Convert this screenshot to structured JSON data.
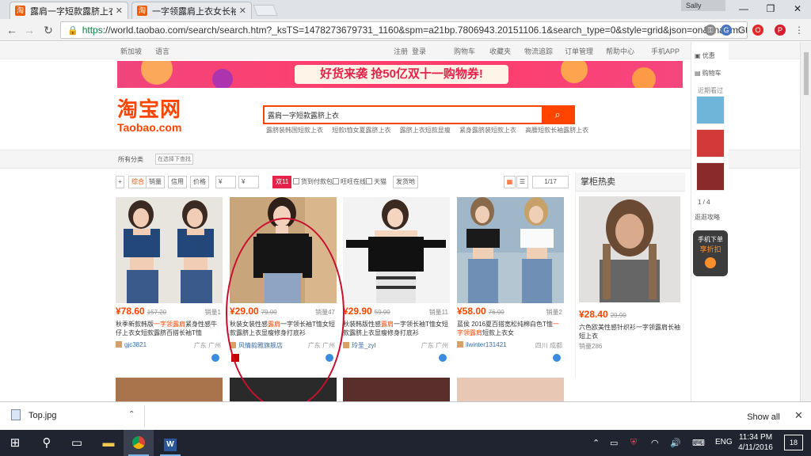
{
  "browser": {
    "tabs": [
      {
        "title": "露肩一字短款露脐上衣_",
        "active": true
      },
      {
        "title": "一字领露肩上衣女长袖t恤",
        "active": false
      }
    ],
    "user": "Sally",
    "url_scheme": "https",
    "url_rest": "://world.taobao.com/search/search.htm?_ksTS=1478273679731_1160&spm=a21bp.7806943.20151106.1&search_type=0&style=grid&json=on&cna=mGt0"
  },
  "site_topbar": {
    "left": [
      "新加坡",
      "语言"
    ],
    "right": [
      "注册",
      "登录",
      "购物车",
      "收藏夹",
      "物流追踪",
      "订单管理",
      "帮助中心",
      "手机APP"
    ]
  },
  "banner": {
    "text": "好货来袭 抢50亿双十一购物券!"
  },
  "logo": {
    "cn": "淘宝网",
    "en": "Taobao.com"
  },
  "search": {
    "query": "露肩一字短款露脐上衣",
    "button_icon": "search-icon",
    "hot_terms": [
      "露脐装韩国短款上衣",
      "短款t恤女夏露脐上衣",
      "露脐上衣短款显瘦",
      "紧身露脐装短款上衣",
      "高腰短款长袖露脐上衣"
    ]
  },
  "category_bar": {
    "label": "所有分类",
    "placeholder": "在选择下查找"
  },
  "filters": {
    "sort": [
      "综合",
      "销量",
      "信用",
      "价格"
    ],
    "price_from": "¥",
    "price_to": "¥",
    "badge": "双11",
    "checks": [
      "货到付款包邮",
      "旺旺在线",
      "天猫"
    ],
    "ship": "发货地",
    "page": "1/17"
  },
  "products": [
    {
      "price": "¥78.60",
      "old": "157.20",
      "sales": "销量1",
      "title_pre": "秋季新款韩版",
      "title_hl": "一字领露肩",
      "title_post": "紧身性感牛仔上衣女短款露脐百搭长袖T恤",
      "shop": "gjc3821",
      "loc": "广东 广州"
    },
    {
      "price": "¥29.00",
      "old": "79.00",
      "sales": "销量47",
      "title_pre": "秋装女装性感",
      "title_hl": "露肩",
      "title_post": "一字领长袖T恤女短款露脐上衣显瘦修身打底衫",
      "shop": "风情韵雅旗舰店",
      "loc": "广东 广州"
    },
    {
      "price": "¥29.90",
      "old": "59.00",
      "sales": "销量11",
      "title_pre": "秋装韩版性感",
      "title_hl": "露肩",
      "title_post": "一字领长袖T恤女短款露脐上衣显瘦修身打底衫",
      "shop": "玲圣_zyl",
      "loc": "广东 广州"
    },
    {
      "price": "¥58.00",
      "old": "76.00",
      "sales": "销量2",
      "title_pre": "蓝侯 2016夏百搭宽松纯棉白色T恤",
      "title_hl": "一字领露肩",
      "title_post": "短款上衣女",
      "shop": "ilwinter131421",
      "loc": "四川 成都"
    }
  ],
  "side_ad": {
    "title": "掌柜热卖",
    "price": "¥28.40",
    "old": "29.90",
    "desc": "六色欧美性感针织衫一字领露肩长袖短上衣",
    "sales": "销量286"
  },
  "right_bar": {
    "items": [
      "优惠",
      "购物车"
    ],
    "recent": "近期看过",
    "pager": "1 / 4",
    "tip": "逛逛攻略",
    "promo1": "手机下单",
    "promo2": "享折扣"
  },
  "download_bar": {
    "file": "Top.jpg",
    "show_all": "Show all"
  },
  "taskbar": {
    "lang": "ENG",
    "time": "11:34 PM",
    "date": "4/11/2016",
    "notif": "18"
  }
}
